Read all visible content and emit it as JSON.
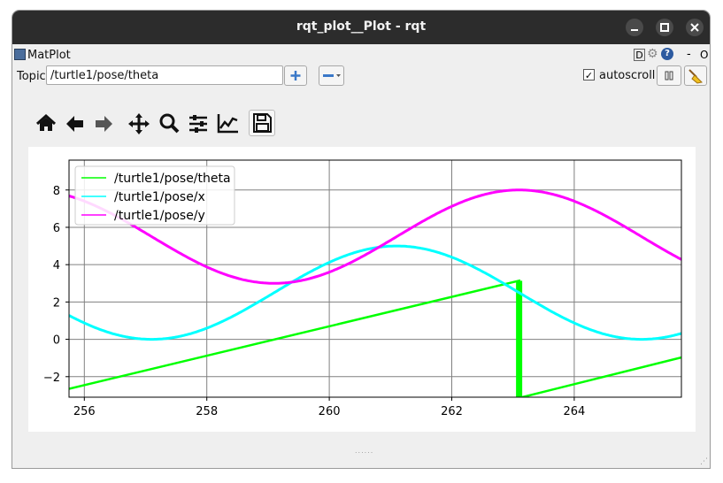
{
  "window": {
    "title": "rqt_plot__Plot - rqt"
  },
  "plugin": {
    "label": "MatPlot",
    "d_label": "D",
    "help_label": "?",
    "dash_label": "-",
    "o_label": "O"
  },
  "topic": {
    "label": "Topic",
    "value": "/turtle1/pose/theta"
  },
  "autoscroll": {
    "label": "autoscroll",
    "checked": true
  },
  "toolbar": {
    "icons": [
      "home-icon",
      "back-arrow-icon",
      "forward-arrow-icon",
      "pan-icon",
      "zoom-icon",
      "subplots-icon",
      "axes-edit-icon",
      "save-icon"
    ]
  },
  "chart_data": {
    "type": "line",
    "title": "",
    "xlabel": "",
    "ylabel": "",
    "xlim": [
      255.75,
      265.75
    ],
    "ylim": [
      -3.1,
      9.6
    ],
    "xticks": [
      "256",
      "258",
      "260",
      "262",
      "264"
    ],
    "yticks": [
      "−2",
      "0",
      "2",
      "4",
      "6",
      "8"
    ],
    "grid": true,
    "legend": "top-left",
    "colors": {
      "theta": "#00ff00",
      "x": "#00ffff",
      "y": "#ff00ff"
    },
    "series": [
      {
        "name": "/turtle1/pose/theta",
        "color": "#00ff00",
        "segments": [
          [
            [
              255.75,
              -2.65
            ],
            [
              263.1,
              3.14
            ]
          ],
          [
            [
              263.1,
              -3.14
            ],
            [
              265.75,
              -0.97
            ]
          ]
        ]
      },
      {
        "name": "/turtle1/pose/x",
        "color": "#00ffff",
        "model": "sinusoid",
        "center": 2.5,
        "amplitude": 2.5,
        "period": 8.0,
        "peak_x": 261.1
      },
      {
        "name": "/turtle1/pose/y",
        "color": "#ff00ff",
        "model": "sinusoid",
        "center": 5.5,
        "amplitude": 2.5,
        "period": 8.0,
        "peak_x": 263.1
      }
    ]
  }
}
